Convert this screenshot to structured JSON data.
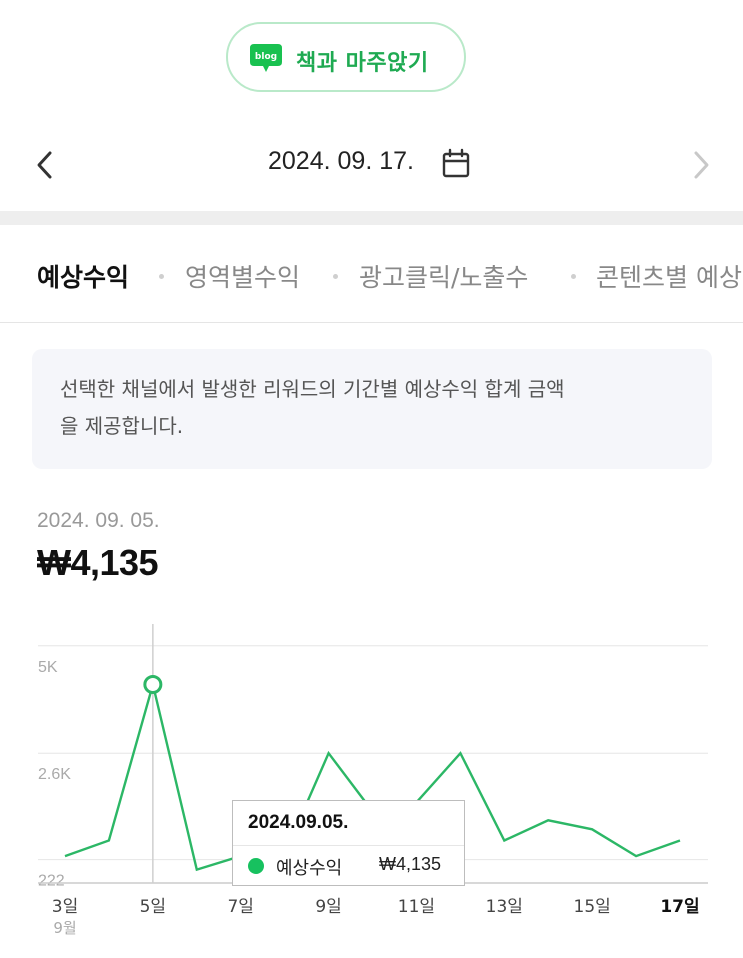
{
  "blog": {
    "badge_text": "blog",
    "name": "책과 마주앉기"
  },
  "date_nav": {
    "date": "2024. 09. 17."
  },
  "tabs": [
    {
      "label": "예상수익",
      "active": true
    },
    {
      "label": "영역별수익",
      "active": false
    },
    {
      "label": "광고클릭/노출수",
      "active": false
    },
    {
      "label": "콘텐츠별 예상",
      "active": false
    }
  ],
  "info": {
    "line1": "선택한 채널에서 발생한 리워드의 기간별 예상수익 합계 금액",
    "line2": "을 제공합니다."
  },
  "selected": {
    "date": "2024. 09. 05.",
    "amount": "₩4,135"
  },
  "tooltip": {
    "date": "2024.09.05.",
    "series_label": "예상수익",
    "value": "₩4,135"
  },
  "colors": {
    "brand_green": "#1faa52",
    "line_green": "#2cb766",
    "dot_green": "#17c15f"
  },
  "chart_data": {
    "type": "line",
    "x": [
      3,
      4,
      5,
      6,
      7,
      8,
      9,
      10,
      11,
      12,
      13,
      14,
      15,
      16,
      17
    ],
    "series": [
      {
        "name": "예상수익",
        "values": [
          300,
          650,
          4135,
          0,
          300,
          350,
          2600,
          1300,
          1500,
          2600,
          650,
          1100,
          900,
          300,
          650
        ]
      }
    ],
    "x_tick_labels": [
      {
        "x": 3,
        "label": "3일",
        "sub": "9월"
      },
      {
        "x": 5,
        "label": "5일"
      },
      {
        "x": 7,
        "label": "7일"
      },
      {
        "x": 9,
        "label": "9일"
      },
      {
        "x": 11,
        "label": "11일"
      },
      {
        "x": 13,
        "label": "13일"
      },
      {
        "x": 15,
        "label": "15일"
      },
      {
        "x": 17,
        "label": "17일",
        "bold": true
      }
    ],
    "y_ticks": [
      {
        "value": 5000,
        "label": "5K"
      },
      {
        "value": 2600,
        "label": "2.6K"
      },
      {
        "value": 222,
        "label": "222"
      }
    ],
    "ylim": [
      -300,
      4950
    ],
    "highlight_x": 5,
    "grid": true
  }
}
